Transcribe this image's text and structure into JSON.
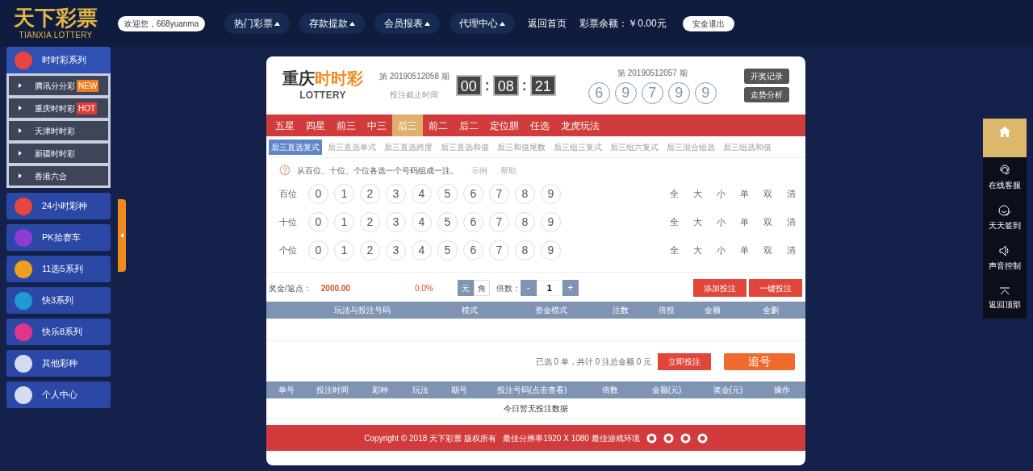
{
  "header": {
    "logo": {
      "title": "天下彩票",
      "subtitle": "TIANXIA LOTTERY"
    },
    "welcome": "欢迎您，668yuanma",
    "nav": [
      {
        "label": "热门彩票",
        "dropdown": true
      },
      {
        "label": "存款提款",
        "dropdown": true
      },
      {
        "label": "会员报表",
        "dropdown": true
      },
      {
        "label": "代理中心",
        "dropdown": true
      },
      {
        "label": "返回首页",
        "dropdown": false
      }
    ],
    "balance": "彩票余额：￥0.00元",
    "logout": "安全退出"
  },
  "sidebar": [
    {
      "label": "时时彩系列",
      "color": "#e8453c",
      "expanded": true,
      "children": [
        {
          "label": "腾讯分分彩",
          "badge": {
            "text": "NEW",
            "color": "#f07c1e"
          }
        },
        {
          "label": "重庆时时彩",
          "badge": {
            "text": "HOT",
            "color": "#e53935"
          }
        },
        {
          "label": "天津时时彩"
        },
        {
          "label": "新疆时时彩"
        },
        {
          "label": "香港六合"
        }
      ]
    },
    {
      "label": "24小时彩种",
      "color": "#e8453c",
      "expanded": false
    },
    {
      "label": "PK拾赛车",
      "color": "#8e3bd6",
      "expanded": false
    },
    {
      "label": "11选5系列",
      "color": "#f0a020",
      "expanded": false
    },
    {
      "label": "快3系列",
      "color": "#1e9ad6",
      "expanded": false
    },
    {
      "label": "快乐8系列",
      "color": "#e0358a",
      "expanded": false
    },
    {
      "label": "其他彩种",
      "color": "#d5dcf0",
      "expanded": false
    },
    {
      "label": "个人中心",
      "color": "#d5dcf0",
      "expanded": false
    }
  ],
  "game": {
    "name_plain": "重庆",
    "name_accent": "时时彩",
    "name_sub": "LOTTERY",
    "current_issue": "第 20190512058 期",
    "countdown_label": "投注截止时间",
    "countdown": [
      "00",
      "08",
      "21"
    ],
    "countdown_separator": ":",
    "last_issue": "第 20190512057 期",
    "last_numbers": [
      "6",
      "9",
      "7",
      "9",
      "9"
    ],
    "side_buttons": [
      "开奖记录",
      "走势分析"
    ],
    "tabs": [
      {
        "label": "五星",
        "selected": false
      },
      {
        "label": "四星",
        "selected": false
      },
      {
        "label": "前三",
        "selected": false
      },
      {
        "label": "中三",
        "selected": false
      },
      {
        "label": "后三",
        "selected": true
      },
      {
        "label": "前二",
        "selected": false
      },
      {
        "label": "后二",
        "selected": false
      },
      {
        "label": "定位胆",
        "selected": false
      },
      {
        "label": "任选",
        "selected": false
      },
      {
        "label": "龙虎玩法",
        "selected": false
      }
    ],
    "subtabs": [
      {
        "label": "后三直选复式",
        "selected": true
      },
      {
        "label": "后三直选单式",
        "selected": false
      },
      {
        "label": "后三直选跨度",
        "selected": false
      },
      {
        "label": "后三直选和值",
        "selected": false
      },
      {
        "label": "后三和值尾数",
        "selected": false
      },
      {
        "label": "后三组三复式",
        "selected": false
      },
      {
        "label": "后三组六复式",
        "selected": false
      },
      {
        "label": "后三混合组选",
        "selected": false
      },
      {
        "label": "后三组选和值",
        "selected": false
      }
    ],
    "hint": "从百位、十位、个位各选一个号码组成一注。",
    "hint_links": [
      "示例",
      "帮助"
    ],
    "rows": [
      {
        "label": "百位",
        "numbers": [
          "0",
          "1",
          "2",
          "3",
          "4",
          "5",
          "6",
          "7",
          "8",
          "9"
        ],
        "filters": [
          "全",
          "大",
          "小",
          "单",
          "双",
          "清"
        ]
      },
      {
        "label": "十位",
        "numbers": [
          "0",
          "1",
          "2",
          "3",
          "4",
          "5",
          "6",
          "7",
          "8",
          "9"
        ],
        "filters": [
          "全",
          "大",
          "小",
          "单",
          "双",
          "清"
        ]
      },
      {
        "label": "个位",
        "numbers": [
          "0",
          "1",
          "2",
          "3",
          "4",
          "5",
          "6",
          "7",
          "8",
          "9"
        ],
        "filters": [
          "全",
          "大",
          "小",
          "单",
          "双",
          "清"
        ]
      }
    ],
    "bet": {
      "prize_label": "奖金/返点：",
      "prize": "2000.00",
      "rebate": "0.0%",
      "units": [
        {
          "label": "元",
          "selected": true
        },
        {
          "label": "角",
          "selected": false
        }
      ],
      "multiple_label": "倍数：",
      "minus": "-",
      "multiple": "1",
      "plus": "+",
      "add": "添加投注",
      "quick": "一键投注"
    },
    "cart_columns": [
      "玩法与投注号码",
      "模式",
      "资金模式",
      "注数",
      "倍投",
      "金额",
      "全删"
    ],
    "summary": "已选 0 单，共计 0 注总金额 0 元",
    "submit": "立即投注",
    "chase": "追号",
    "history_columns": [
      "单号",
      "投注时间",
      "彩种",
      "玩法",
      "期号",
      "投注号码(点击查看)",
      "倍数",
      "金额(元)",
      "奖金(元)",
      "操作"
    ],
    "history_empty": "今日暂无投注数据",
    "footer": "Copyright © 2018 天下彩票 版权所有   最佳分辨率1920 X 1080 最佳游戏环境"
  },
  "tools": [
    {
      "kind": "home"
    },
    {
      "kind": "service",
      "label": "在线客服"
    },
    {
      "kind": "checkin",
      "label": "天天签到"
    },
    {
      "kind": "sound",
      "label": "声音控制"
    },
    {
      "kind": "top",
      "label": "返回顶部"
    }
  ]
}
